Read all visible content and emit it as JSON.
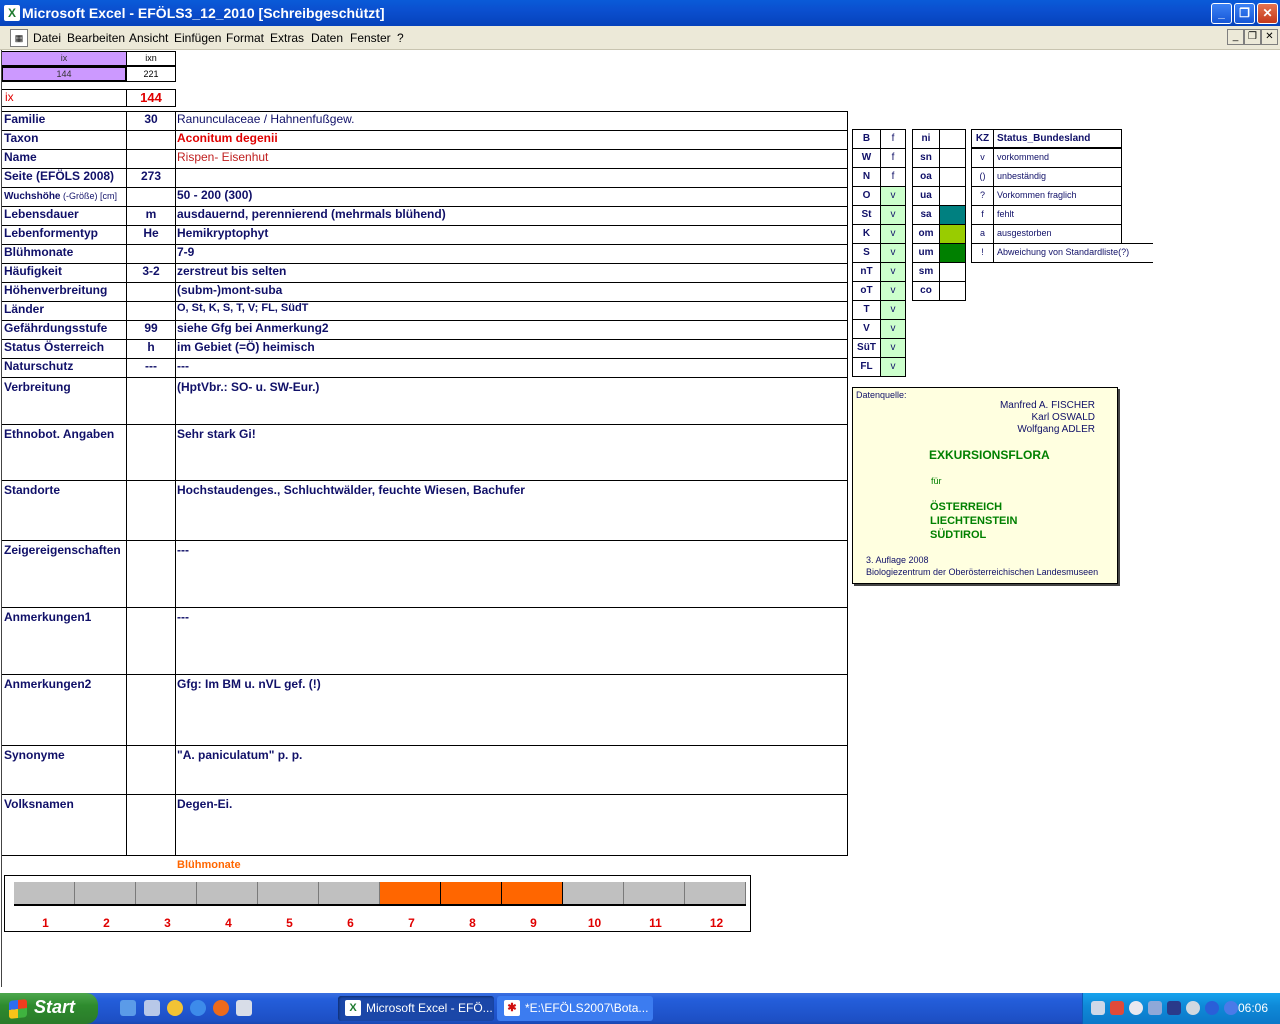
{
  "window": {
    "title": "Microsoft Excel - EFÖLS3_12_2010  [Schreibgeschützt]",
    "app_icon_glyph": "X",
    "buttons": {
      "minimize": "_",
      "restore": "❐",
      "close": "✕"
    }
  },
  "menubar": {
    "items": [
      "Datei",
      "Bearbeiten",
      "Ansicht",
      "Einfügen",
      "Format",
      "Extras",
      "Daten",
      "Fenster",
      "?"
    ],
    "mdi_buttons": {
      "minimize": "_",
      "restore": "❐",
      "close": "✕"
    }
  },
  "top_boxes": {
    "ix_header": "ix",
    "ixn_header": "ixn",
    "ix_value_small": "144",
    "ixn_value": "221",
    "ix_label": "ix",
    "ix_value": "144"
  },
  "fields": [
    {
      "label": "Familie",
      "code": "30",
      "value": "Ranunculaceae  /  Hahnenfußgew."
    },
    {
      "label": "Taxon",
      "code": "",
      "value": "Aconitum degenii"
    },
    {
      "label": "Name",
      "code": "",
      "value": "Rispen- Eisenhut"
    },
    {
      "label": "Seite (EFÖLS 2008)",
      "code": "273",
      "value": ""
    },
    {
      "label": "Wuchshöhe",
      "label_suffix": " (-Größe) [cm]",
      "code": "",
      "value": " 50 - 200 (300)"
    },
    {
      "label": "Lebensdauer",
      "code": "m",
      "value": "ausdauernd, perennierend (mehrmals blühend)"
    },
    {
      "label": "Lebenformentyp",
      "code": "He",
      "value": "Hemikryptophyt"
    },
    {
      "label": "Blühmonate",
      "code": "",
      "value": " 7-9"
    },
    {
      "label": "Häufigkeit",
      "code": "3-2",
      "value": "zerstreut bis selten"
    },
    {
      "label": "Höhenverbreitung",
      "code": "",
      "value": "(subm-)mont-suba"
    },
    {
      "label": "Länder",
      "code": "",
      "value": "O, St, K, S, T, V; FL, SüdT"
    },
    {
      "label": "Gefährdungsstufe",
      "code": "99",
      "value": "siehe Gfg bei Anmerkung2"
    },
    {
      "label": "Status Österreich",
      "code": "h",
      "value": "im Gebiet (=Ö) heimisch"
    },
    {
      "label": "Naturschutz",
      "code": "---",
      "value": " ---"
    },
    {
      "label": "Verbreitung",
      "code": "",
      "value": "(HptVbr.: SO- u. SW-Eur.)"
    },
    {
      "label": "Ethnobot. Angaben",
      "code": "",
      "value": "Sehr stark Gi!"
    },
    {
      "label": "Standorte",
      "code": "",
      "value": "Hochstaudenges., Schluchtwälder, feuchte Wiesen, Bachufer"
    },
    {
      "label": "Zeigereigenschaften",
      "code": "",
      "value": "---"
    },
    {
      "label": "Anmerkungen1",
      "code": "",
      "value": "---"
    },
    {
      "label": "Anmerkungen2",
      "code": "",
      "value": "Gfg: Im BM u. nVL gef. (!)"
    },
    {
      "label": "Synonyme",
      "code": "",
      "value": "\"A. paniculatum\" p. p."
    },
    {
      "label": "Volksnamen",
      "code": "",
      "value": "Degen-Ei."
    }
  ],
  "states_table": [
    {
      "code": "B",
      "status": "f"
    },
    {
      "code": "W",
      "status": "f"
    },
    {
      "code": "N",
      "status": "f"
    },
    {
      "code": "O",
      "status": "v"
    },
    {
      "code": "St",
      "status": "v"
    },
    {
      "code": "K",
      "status": "v"
    },
    {
      "code": "S",
      "status": "v"
    },
    {
      "code": "nT",
      "status": "v"
    },
    {
      "code": "oT",
      "status": "v"
    },
    {
      "code": "T",
      "status": "v"
    },
    {
      "code": "V",
      "status": "v"
    },
    {
      "code": "SüT",
      "status": "v"
    },
    {
      "code": "FL",
      "status": "v"
    }
  ],
  "altitude_table": [
    {
      "code": "ni",
      "color": "#ffffff"
    },
    {
      "code": "sn",
      "color": "#ffffff"
    },
    {
      "code": "oa",
      "color": "#ffffff"
    },
    {
      "code": "ua",
      "color": "#ffffff"
    },
    {
      "code": "sa",
      "color": "#008080"
    },
    {
      "code": "om",
      "color": "#99cc00"
    },
    {
      "code": "um",
      "color": "#008000"
    },
    {
      "code": "sm",
      "color": "#ffffff"
    },
    {
      "code": "co",
      "color": "#ffffff"
    }
  ],
  "legend_table": {
    "header_kz": "KZ",
    "header_status": "Status_Bundesland",
    "rows": [
      {
        "kz": "v",
        "text": "vorkommend"
      },
      {
        "kz": "()",
        "text": "unbeständig"
      },
      {
        "kz": "?",
        "text": "Vorkommen fraglich"
      },
      {
        "kz": "f",
        "text": "fehlt"
      },
      {
        "kz": "a",
        "text": "ausgestorben"
      },
      {
        "kz": "!",
        "text": "Abweichung von Standardliste(?)"
      }
    ]
  },
  "infobox": {
    "source_label": "Datenquelle:",
    "authors": [
      "Manfred A. FISCHER",
      "Karl OSWALD",
      "Wolfgang ADLER"
    ],
    "title": "EXKURSIONSFLORA",
    "fuer": "für",
    "countries": [
      "ÖSTERREICH",
      "LIECHTENSTEIN",
      "SÜDTIROL"
    ],
    "edition": "3. Auflage 2008",
    "publisher": "Biologiezentrum der Oberösterreichischen Landesmuseen"
  },
  "bluehmonate": {
    "title": "Blühmonate",
    "months": [
      "1",
      "2",
      "3",
      "4",
      "5",
      "6",
      "7",
      "8",
      "9",
      "10",
      "11",
      "12"
    ],
    "active": [
      7,
      8,
      9
    ],
    "active_color": "#ff6600",
    "inactive_color": "#c0c0c0"
  },
  "taskbar": {
    "start_label": "Start",
    "tasks": [
      {
        "label": "Microsoft Excel - EFÖ...",
        "icon": "X"
      },
      {
        "label": "*E:\\EFÖLS2007\\Bota...",
        "icon": "✱"
      }
    ],
    "clock": "06:06"
  }
}
